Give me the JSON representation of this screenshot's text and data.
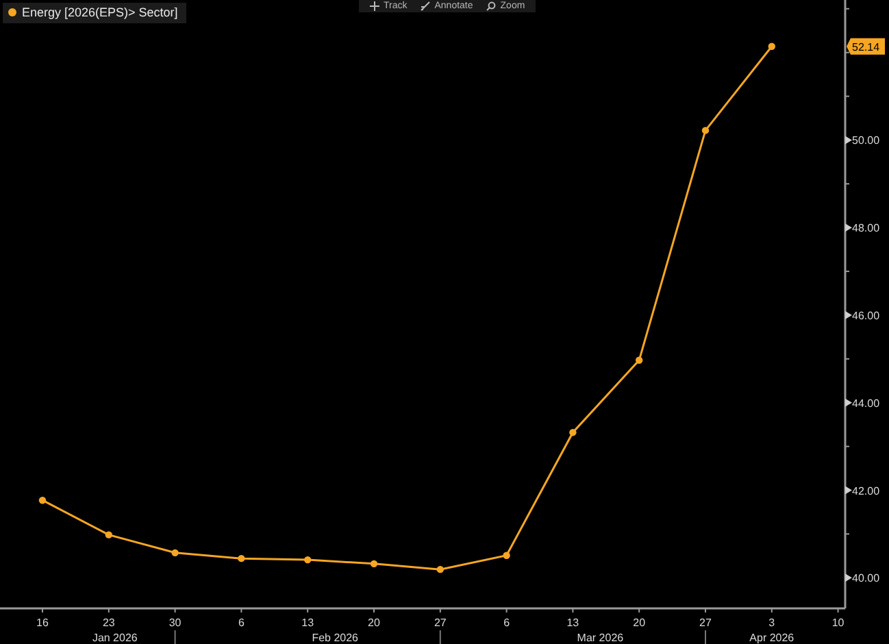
{
  "toolbar": [
    {
      "kind": "track",
      "label": "Track"
    },
    {
      "kind": "annotate",
      "label": "Annotate"
    },
    {
      "kind": "zoom",
      "label": "Zoom"
    }
  ],
  "chart": {
    "last_value_label": "52.14",
    "x_groups": [
      {
        "label": "Jan 2026"
      },
      {
        "label": "Feb 2026"
      },
      {
        "label": "Mar 2026"
      },
      {
        "label": "Apr 2026"
      }
    ],
    "chart_data": {
      "type": "line",
      "categories": [
        "16",
        "23",
        "30",
        "6",
        "13",
        "20",
        "27",
        "6",
        "13",
        "20",
        "27",
        "3",
        "10"
      ],
      "series": [
        {
          "name": "Energy [2026(EPS)> Sector]",
          "color": "#f5a623",
          "marker": "circle",
          "values": [
            41.77,
            40.98,
            40.57,
            40.44,
            40.41,
            40.32,
            40.19,
            40.51,
            43.32,
            44.97,
            50.22,
            52.14,
            null
          ]
        }
      ],
      "ylim": [
        39.3,
        53.2
      ],
      "yticks": [
        {
          "value": 40,
          "label": "40.00"
        },
        {
          "value": 42,
          "label": "42.00"
        },
        {
          "value": 44,
          "label": "44.00"
        },
        {
          "value": 46,
          "label": "46.00"
        },
        {
          "value": 48,
          "label": "48.00"
        },
        {
          "value": 50,
          "label": "50.00"
        }
      ]
    }
  }
}
